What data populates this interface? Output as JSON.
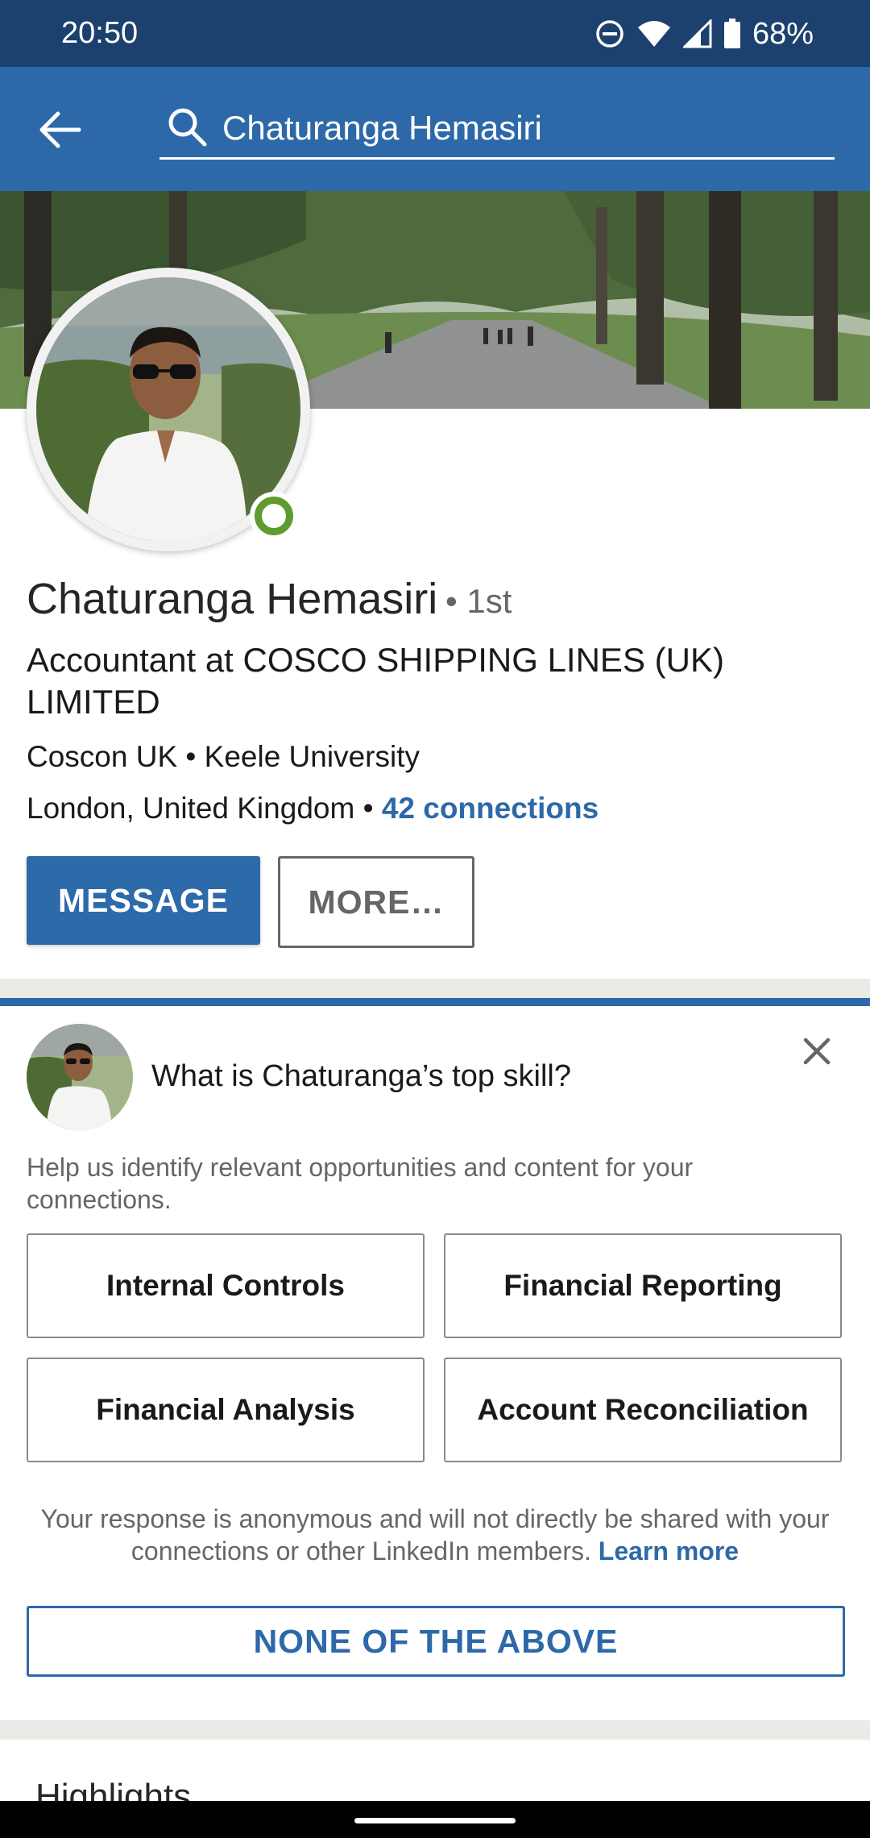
{
  "status_bar": {
    "time": "20:50",
    "battery": "68%",
    "icons": [
      "do-not-disturb-icon",
      "wifi-icon",
      "signal-icon",
      "battery-icon"
    ]
  },
  "app_bar": {
    "back_icon": "back-arrow-icon",
    "search_icon": "search-icon",
    "search_query": "Chaturanga Hemasiri"
  },
  "profile": {
    "name": "Chaturanga Hemasiri",
    "degree": "1st",
    "headline": "Accountant at COSCO SHIPPING LINES (UK) LIMITED",
    "meta": "Coscon UK • Keele University",
    "location": "London, United Kingdom",
    "connections": "42 connections",
    "status": "online"
  },
  "actions": {
    "message": "MESSAGE",
    "more": "MORE…"
  },
  "skill_card": {
    "question": "What is Chaturanga’s top skill?",
    "help_text": "Help us identify relevant opportunities and content for your connections.",
    "skills": [
      "Internal Controls",
      "Financial Reporting",
      "Financial Analysis",
      "Account Reconciliation"
    ],
    "anonymous_text": "Your response is anonymous and will not directly be shared with your connections or other LinkedIn members.",
    "learn_more": "Learn more",
    "none_button": "NONE OF THE ABOVE"
  },
  "highlights": {
    "title": "Highlights"
  },
  "colors": {
    "primary": "#2d69a8",
    "status_bar": "#1d416e",
    "online": "#5d9b2e"
  }
}
